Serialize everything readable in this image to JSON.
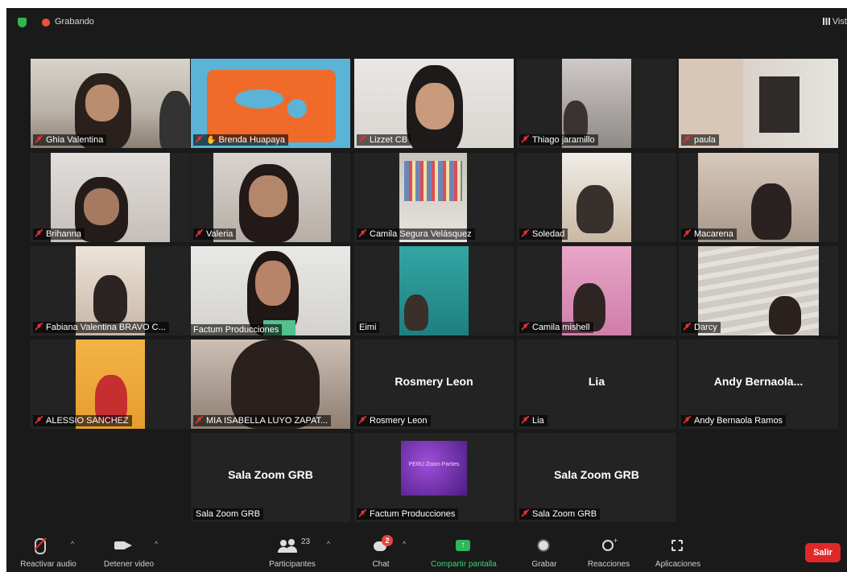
{
  "topbar": {
    "recording_label": "Grabando",
    "view_label": "Vista"
  },
  "gallery": {
    "participants": [
      {
        "name": "Ghia Valentina",
        "muted": true
      },
      {
        "name": "Brenda Huapaya",
        "muted": true,
        "active_speaker": true
      },
      {
        "name": "Lizzet CB",
        "muted": true
      },
      {
        "name": "Thiago jaramillo",
        "muted": true
      },
      {
        "name": "paula",
        "muted": true
      },
      {
        "name": "Brihanna",
        "muted": true
      },
      {
        "name": "Valeria",
        "muted": true
      },
      {
        "name": "Camila Segura Velásquez",
        "muted": true
      },
      {
        "name": "Soledad",
        "muted": true
      },
      {
        "name": "Macarena",
        "muted": true
      },
      {
        "name": "Fabiana Valentina BRAVO C...",
        "muted": true
      },
      {
        "name": "Factum Producciones",
        "muted": false
      },
      {
        "name": "Eimi",
        "muted": false
      },
      {
        "name": "Camila mishell",
        "muted": true
      },
      {
        "name": "Darcy",
        "muted": true
      },
      {
        "name": "ALESSIO SANCHEZ",
        "muted": true
      },
      {
        "name": "MIA ISABELLA LUYO ZAPAT...",
        "muted": true
      },
      {
        "name": "Rosmery Leon",
        "center": "Rosmery Leon",
        "muted": true
      },
      {
        "name": "Lia",
        "center": "Lia",
        "muted": true
      },
      {
        "name": "Andy Bernaola Ramos",
        "center": "Andy  Bernaola...",
        "muted": true
      },
      {
        "name": "Sala Zoom GRB",
        "center": "Sala Zoom GRB",
        "muted": false
      },
      {
        "name": "Factum Producciones",
        "muted": true,
        "thumbnail_text": "PERU Zoom Parties"
      },
      {
        "name": "Sala Zoom GRB",
        "center": "Sala Zoom GRB",
        "muted": true
      }
    ]
  },
  "toolbar": {
    "unmute": "Reactivar audio",
    "stop_video": "Detener video",
    "participants": "Participantes",
    "participants_count": "23",
    "chat": "Chat",
    "chat_badge": "2",
    "share": "Compartir pantalla",
    "record": "Grabar",
    "reactions": "Reacciones",
    "apps": "Aplicaciones",
    "leave": "Salir"
  },
  "colors": {
    "active_speaker": "#cfe86b",
    "leave": "#e02828",
    "share": "#3cd56e",
    "recording": "#e9503f",
    "muted_mic": "#e3302f"
  }
}
